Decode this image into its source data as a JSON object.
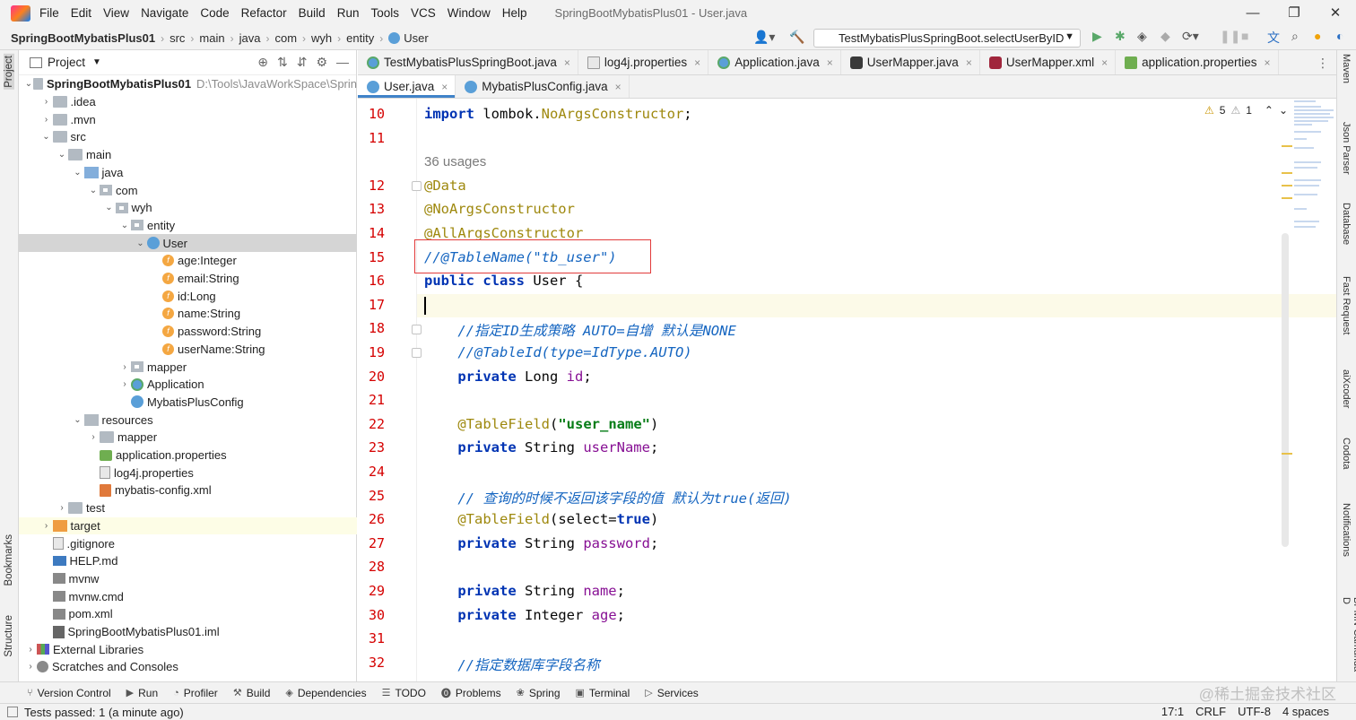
{
  "window": {
    "title": "SpringBootMybatisPlus01 - User.java",
    "menu": [
      "File",
      "Edit",
      "View",
      "Navigate",
      "Code",
      "Refactor",
      "Build",
      "Run",
      "Tools",
      "VCS",
      "Window",
      "Help"
    ],
    "controls": [
      "—",
      "❐",
      "✕"
    ]
  },
  "breadcrumb": [
    "SpringBootMybatisPlus01",
    "src",
    "main",
    "java",
    "com",
    "wyh",
    "entity",
    "User"
  ],
  "run_config": "TestMybatisPlusSpringBoot.selectUserByID",
  "project_panel": {
    "title": "Project",
    "tree": [
      {
        "label": "SpringBootMybatisPlus01",
        "extra": "D:\\Tools\\JavaWorkSpace\\Sprin",
        "depth": 0,
        "arrow": "⌄",
        "icon": "folder"
      },
      {
        "label": ".idea",
        "depth": 1,
        "arrow": "›",
        "icon": "folder"
      },
      {
        "label": ".mvn",
        "depth": 1,
        "arrow": "›",
        "icon": "folder"
      },
      {
        "label": "src",
        "depth": 1,
        "arrow": "⌄",
        "icon": "folder"
      },
      {
        "label": "main",
        "depth": 2,
        "arrow": "⌄",
        "icon": "folder"
      },
      {
        "label": "java",
        "depth": 3,
        "arrow": "⌄",
        "icon": "folder-src"
      },
      {
        "label": "com",
        "depth": 4,
        "arrow": "⌄",
        "icon": "pkg"
      },
      {
        "label": "wyh",
        "depth": 5,
        "arrow": "⌄",
        "icon": "pkg"
      },
      {
        "label": "entity",
        "depth": 6,
        "arrow": "⌄",
        "icon": "pkg"
      },
      {
        "label": "User",
        "depth": 7,
        "arrow": "⌄",
        "icon": "cls",
        "selected": true
      },
      {
        "label": "age:Integer",
        "depth": 8,
        "arrow": "",
        "icon": "field"
      },
      {
        "label": "email:String",
        "depth": 8,
        "arrow": "",
        "icon": "field"
      },
      {
        "label": "id:Long",
        "depth": 8,
        "arrow": "",
        "icon": "field"
      },
      {
        "label": "name:String",
        "depth": 8,
        "arrow": "",
        "icon": "field"
      },
      {
        "label": "password:String",
        "depth": 8,
        "arrow": "",
        "icon": "field"
      },
      {
        "label": "userName:String",
        "depth": 8,
        "arrow": "",
        "icon": "field"
      },
      {
        "label": "mapper",
        "depth": 6,
        "arrow": "›",
        "icon": "pkg"
      },
      {
        "label": "Application",
        "depth": 6,
        "arrow": "›",
        "icon": "clsg"
      },
      {
        "label": "MybatisPlusConfig",
        "depth": 6,
        "arrow": "",
        "icon": "cls"
      },
      {
        "label": "resources",
        "depth": 3,
        "arrow": "⌄",
        "icon": "folder-res"
      },
      {
        "label": "mapper",
        "depth": 4,
        "arrow": "›",
        "icon": "folder"
      },
      {
        "label": "application.properties",
        "depth": 4,
        "arrow": "",
        "icon": "prop"
      },
      {
        "label": "log4j.properties",
        "depth": 4,
        "arrow": "",
        "icon": "file"
      },
      {
        "label": "mybatis-config.xml",
        "depth": 4,
        "arrow": "",
        "icon": "xml"
      },
      {
        "label": "test",
        "depth": 2,
        "arrow": "›",
        "icon": "folder"
      },
      {
        "label": "target",
        "depth": 1,
        "arrow": "›",
        "icon": "folder-target",
        "target": true
      },
      {
        "label": ".gitignore",
        "depth": 1,
        "arrow": "",
        "icon": "file"
      },
      {
        "label": "HELP.md",
        "depth": 1,
        "arrow": "",
        "icon": "md"
      },
      {
        "label": "mvnw",
        "depth": 1,
        "arrow": "",
        "icon": "mvn"
      },
      {
        "label": "mvnw.cmd",
        "depth": 1,
        "arrow": "",
        "icon": "mvn"
      },
      {
        "label": "pom.xml",
        "depth": 1,
        "arrow": "",
        "icon": "mvn"
      },
      {
        "label": "SpringBootMybatisPlus01.iml",
        "depth": 1,
        "arrow": "",
        "icon": "iml"
      },
      {
        "label": "External Libraries",
        "depth": 0,
        "arrow": "›",
        "icon": "lib"
      },
      {
        "label": "Scratches and Consoles",
        "depth": 0,
        "arrow": "›",
        "icon": "scratch"
      }
    ]
  },
  "tabs_row1": [
    {
      "label": "TestMybatisPlusSpringBoot.java",
      "icon": "javag"
    },
    {
      "label": "log4j.properties",
      "icon": "log"
    },
    {
      "label": "Application.java",
      "icon": "javag"
    },
    {
      "label": "UserMapper.java",
      "icon": "mapper"
    },
    {
      "label": "UserMapper.xml",
      "icon": "mxml"
    },
    {
      "label": "application.properties",
      "icon": "props"
    }
  ],
  "tabs_row2": [
    {
      "label": "User.java",
      "icon": "java",
      "active": true
    },
    {
      "label": "MybatisPlusConfig.java",
      "icon": "java"
    }
  ],
  "inspections": {
    "warnings": "5",
    "weak": "1"
  },
  "code": [
    {
      "n": "10",
      "html": "<span class='kw'>import</span> lombok.<span class='imp'>NoArgsConstructor</span>;"
    },
    {
      "n": "11",
      "html": ""
    },
    {
      "n": "",
      "html": "<span class='usages'>36 usages</span>"
    },
    {
      "n": "12",
      "html": "<span class='ann'>@Data</span>"
    },
    {
      "n": "13",
      "html": "<span class='ann'>@NoArgsConstructor</span>"
    },
    {
      "n": "14",
      "html": "<span class='ann'>@AllArgsConstructor</span>"
    },
    {
      "n": "15",
      "html": "<span class='cmt'>//@TableName(\"tb_user\")</span>"
    },
    {
      "n": "16",
      "html": "<span class='kw'>public class</span> User {"
    },
    {
      "n": "17",
      "html": ""
    },
    {
      "n": "18",
      "html": "    <span class='cmt'>//指定ID生成策略 AUTO=自增 默认是NONE</span>"
    },
    {
      "n": "19",
      "html": "    <span class='cmt'>//@TableId(type=IdType.AUTO)</span>"
    },
    {
      "n": "20",
      "html": "    <span class='kw'>private</span> Long <span class='fld'>id</span>;"
    },
    {
      "n": "21",
      "html": ""
    },
    {
      "n": "22",
      "html": "    <span class='ann'>@TableField</span>(<span class='str'>\"user_name\"</span>)"
    },
    {
      "n": "23",
      "html": "    <span class='kw'>private</span> String <span class='fld'>userName</span>;"
    },
    {
      "n": "24",
      "html": ""
    },
    {
      "n": "25",
      "html": "    <span class='cmt'>// 查询的时候不返回该字段的值 默认为true(返回)</span>"
    },
    {
      "n": "26",
      "html": "    <span class='ann'>@TableField</span>(select=<span class='kw'>true</span>)"
    },
    {
      "n": "27",
      "html": "    <span class='kw'>private</span> String <span class='fld'>password</span>;"
    },
    {
      "n": "28",
      "html": ""
    },
    {
      "n": "29",
      "html": "    <span class='kw'>private</span> String <span class='fld'>name</span>;"
    },
    {
      "n": "30",
      "html": "    <span class='kw'>private</span> Integer <span class='fld'>age</span>;"
    },
    {
      "n": "31",
      "html": ""
    },
    {
      "n": "32",
      "html": "    <span class='cmt'>//指定数据库字段名称</span>"
    }
  ],
  "tool_windows": [
    "Version Control",
    "Run",
    "Profiler",
    "Build",
    "Dependencies",
    "TODO",
    "Problems",
    "Spring",
    "Terminal",
    "Services"
  ],
  "status": {
    "message": "Tests passed: 1 (a minute ago)",
    "position": "17:1",
    "line_sep": "CRLF",
    "encoding": "UTF-8",
    "indent": "4 spaces"
  },
  "left_stripe": [
    "Project",
    "Bookmarks",
    "Structure"
  ],
  "right_stripe": [
    "Maven",
    "Json Parser",
    "Database",
    "Fast Request",
    "aiXcoder",
    "Codota",
    "Notifications",
    "BPMN-Camunda-D"
  ],
  "watermark": "@稀土掘金技术社区"
}
